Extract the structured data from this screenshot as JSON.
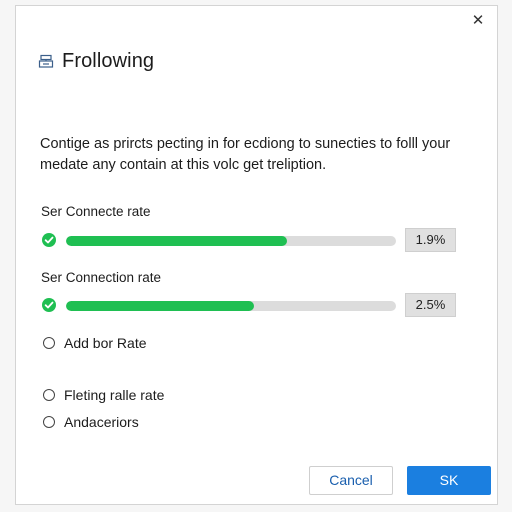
{
  "dialog": {
    "title": "Frollowing",
    "close_glyph": "✕",
    "description": "Contige as prircts pecting in for ecdiong to sunecties to folll your medate any contain at this volc get treliption.",
    "metrics": [
      {
        "label": "Ser Connecte rate",
        "value_text": "1.9%",
        "fill_fraction": 0.67,
        "status_icon": "check-circle-icon"
      },
      {
        "label": "Ser Connection rate",
        "value_text": "2.5%",
        "fill_fraction": 0.57,
        "status_icon": "check-circle-icon"
      }
    ],
    "options": [
      {
        "label": "Add bor Rate",
        "selected": false
      },
      {
        "label": "Fleting ralle rate",
        "selected": false
      },
      {
        "label": "Andaceriors",
        "selected": false
      }
    ],
    "buttons": {
      "cancel": "Cancel",
      "ok": "SK"
    },
    "colors": {
      "accent": "#1b7fe0",
      "success": "#1fbf52",
      "track": "#dcdcdc"
    },
    "title_icon": "server-icon"
  }
}
